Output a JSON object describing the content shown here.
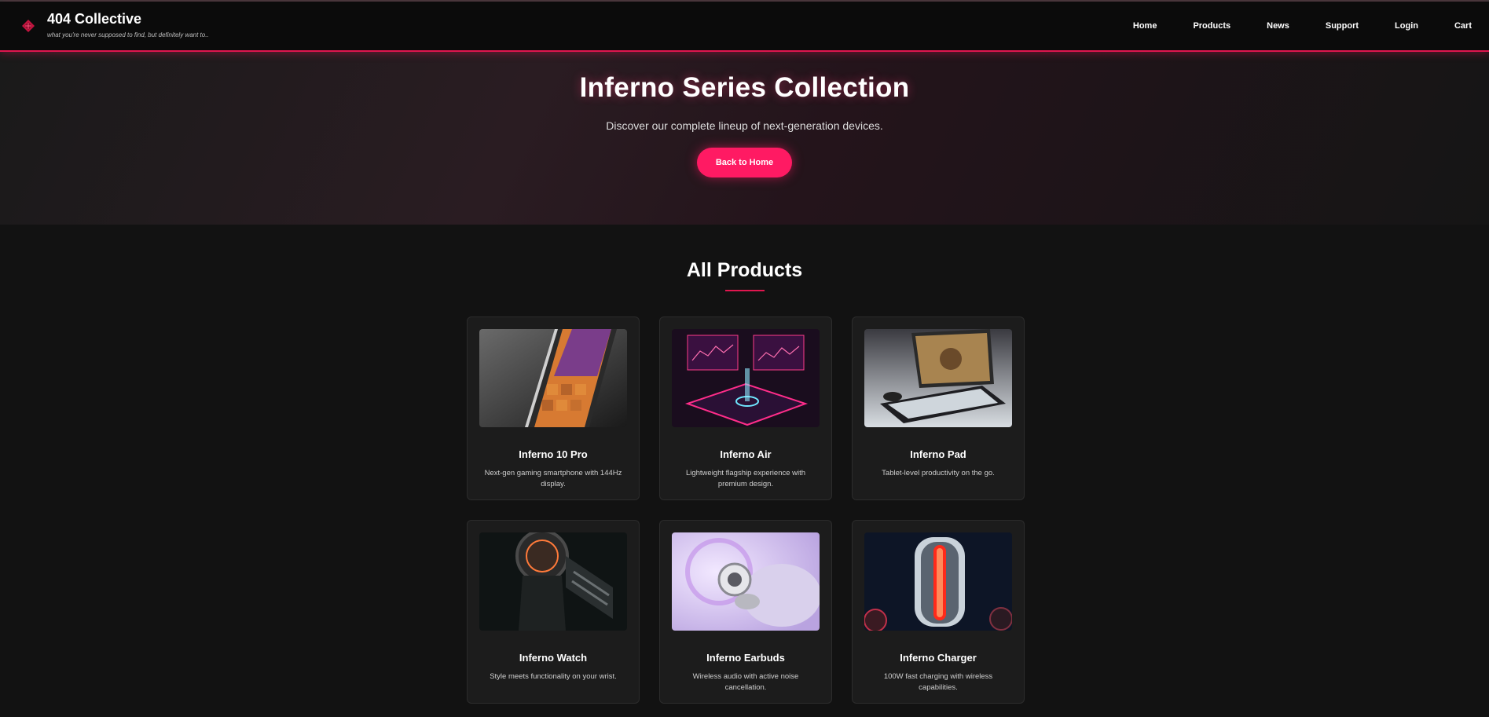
{
  "header": {
    "brand_name": "404 Collective",
    "tagline": "what you're never supposed to find, but definitely want to..",
    "logo_icon": "diamond-logo-icon",
    "nav": [
      {
        "label": "Home"
      },
      {
        "label": "Products"
      },
      {
        "label": "News"
      },
      {
        "label": "Support"
      },
      {
        "label": "Login"
      },
      {
        "label": "Cart"
      }
    ]
  },
  "hero": {
    "title": "Inferno Series Collection",
    "subtitle": "Discover our complete lineup of next-generation devices.",
    "button_label": "Back to Home"
  },
  "products": {
    "heading": "All Products",
    "items": [
      {
        "name": "Inferno 10 Pro",
        "description": "Next-gen gaming smartphone with 144Hz display.",
        "image": "smartphone-image"
      },
      {
        "name": "Inferno Air",
        "description": "Lightweight flagship experience with premium design.",
        "image": "holographic-phone-image"
      },
      {
        "name": "Inferno Pad",
        "description": "Tablet-level productivity on the go.",
        "image": "laptop-image"
      },
      {
        "name": "Inferno Watch",
        "description": "Style meets functionality on your wrist.",
        "image": "smartwatch-image"
      },
      {
        "name": "Inferno Earbuds",
        "description": "Wireless audio with active noise cancellation.",
        "image": "earbuds-image"
      },
      {
        "name": "Inferno Charger",
        "description": "100W fast charging with wireless capabilities.",
        "image": "charger-image"
      }
    ]
  },
  "colors": {
    "accent": "#ff1a63",
    "background": "#121212",
    "card": "#1c1c1c"
  }
}
